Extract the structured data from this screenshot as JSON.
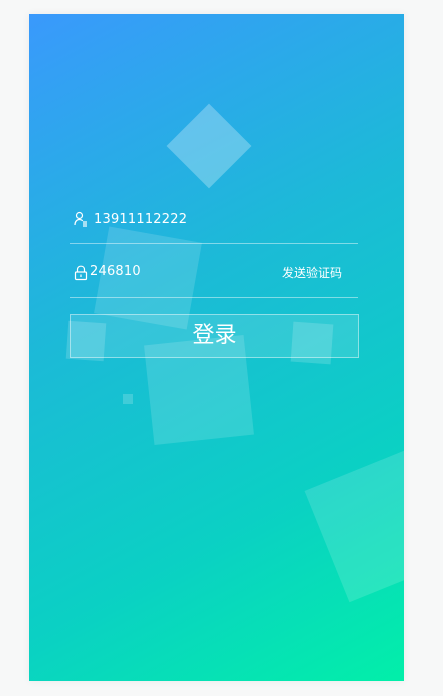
{
  "colors": {
    "gradient_start": "#3a99fc",
    "gradient_end": "#02efa9",
    "text": "#ffffff"
  },
  "login_form": {
    "phone_value": "13911112222",
    "code_value": "246810",
    "send_code_label": "发送验证码",
    "login_label": "登录",
    "phone_icon": "user-icon",
    "code_icon": "lock-icon"
  }
}
